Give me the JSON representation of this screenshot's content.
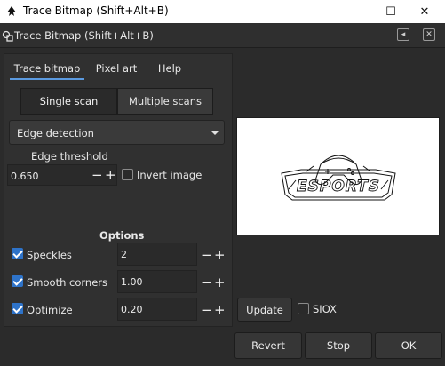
{
  "window": {
    "title": "Trace Bitmap (Shift+Alt+B)",
    "min_glyph": "—",
    "max_glyph": "☐",
    "close_glyph": "✕"
  },
  "dock": {
    "title": "Trace Bitmap (Shift+Alt+B)",
    "btn1_glyph": "◂",
    "btn2_glyph": "✕"
  },
  "tabs": [
    {
      "label": "Trace bitmap",
      "active": true
    },
    {
      "label": "Pixel art",
      "active": false
    },
    {
      "label": "Help",
      "active": false
    }
  ],
  "scan_mode": {
    "single": "Single scan",
    "multiple": "Multiple scans",
    "selected": "single"
  },
  "detection": {
    "selected": "Edge detection"
  },
  "edge_threshold": {
    "label": "Edge threshold",
    "value": "0.650",
    "minus": "−",
    "plus": "+"
  },
  "invert_image": {
    "label": "Invert image",
    "checked": false
  },
  "options": {
    "heading": "Options",
    "rows": [
      {
        "label": "Speckles",
        "checked": true,
        "value": "2"
      },
      {
        "label": "Smooth corners",
        "checked": true,
        "value": "1.00"
      },
      {
        "label": "Optimize",
        "checked": true,
        "value": "0.20"
      }
    ]
  },
  "preview": {
    "logo_text": "ESPORTS"
  },
  "update": {
    "label": "Update"
  },
  "siox": {
    "label": "SIOX",
    "checked": false
  },
  "buttons": {
    "revert": "Revert",
    "stop": "Stop",
    "ok": "OK"
  },
  "colors": {
    "accent": "#2e73c9",
    "panel": "#303030",
    "background": "#2b2b2b"
  }
}
